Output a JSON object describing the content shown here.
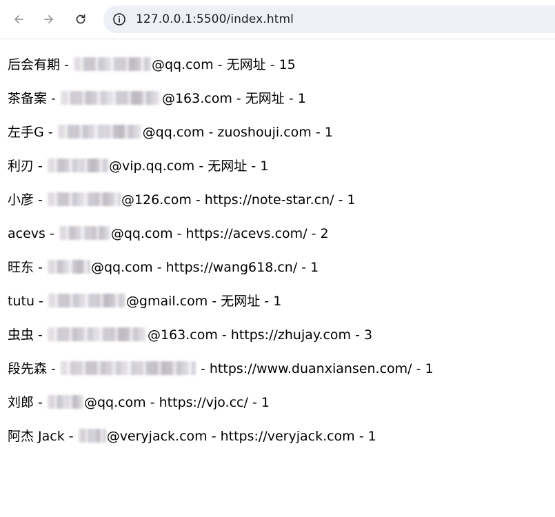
{
  "browser": {
    "url": "127.0.0.1:5500/index.html"
  },
  "entries": [
    {
      "name": "后会有期",
      "prefix": " - ",
      "email_domain": "@qq.com",
      "url": "无网址",
      "count": "15"
    },
    {
      "name": "茶备案",
      "prefix": " - ",
      "email_domain": "@163.com",
      "url": "无网址",
      "count": "1"
    },
    {
      "name": "左手G",
      "prefix": " - ",
      "email_domain": "@qq.com",
      "url": "zuoshouji.com",
      "count": "1"
    },
    {
      "name": "利刃",
      "prefix": " - ",
      "email_domain": "@vip.qq.com",
      "url": "无网址",
      "count": "1"
    },
    {
      "name": "小彦",
      "prefix": " - ",
      "email_domain": "@126.com",
      "url": "https://note-star.cn/",
      "count": "1"
    },
    {
      "name": "acevs",
      "prefix": " - ",
      "email_domain": "@qq.com",
      "url": "https://acevs.com/",
      "count": "2"
    },
    {
      "name": "旺东",
      "prefix": " - ",
      "email_domain": "@qq.com",
      "url": "https://wang618.cn/",
      "count": "1"
    },
    {
      "name": "tutu",
      "prefix": " - ",
      "email_domain": "@gmail.com",
      "url": "无网址",
      "count": "1"
    },
    {
      "name": "虫虫",
      "prefix": " - ",
      "email_domain": "@163.com",
      "url": "https://zhujay.com",
      "count": "3"
    },
    {
      "name": "段先森",
      "prefix": " - ",
      "email_domain": "",
      "url": "https://www.duanxiansen.com/",
      "count": "1"
    },
    {
      "name": "刘郎",
      "prefix": " - ",
      "email_domain": "@qq.com",
      "url": "https://vjo.cc/",
      "count": "1"
    },
    {
      "name": "阿杰 Jack",
      "prefix": " - ",
      "email_domain": "@veryjack.com",
      "url": "https://veryjack.com",
      "count": "1"
    }
  ],
  "separator": " - "
}
